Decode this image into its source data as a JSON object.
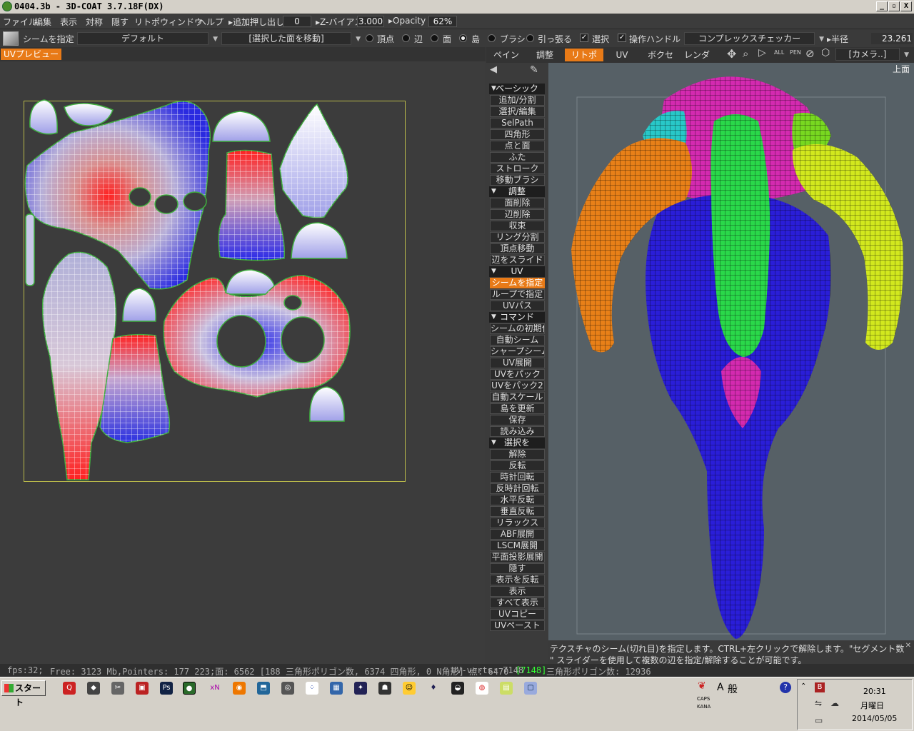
{
  "window": {
    "title": "0404.3b - 3D-COAT 3.7.18F(DX)",
    "buttons": [
      "_",
      "▫",
      "X"
    ]
  },
  "menu": {
    "items": [
      "ファイル",
      "編集",
      "表示",
      "対称",
      "隠す",
      "リトポ",
      "ウィンドウ",
      "ヘルプ"
    ],
    "extrude_label": "▸追加押し出し",
    "extrude_value": "0",
    "zbias_label": "▸Z-バイアス",
    "zbias_value": "3.000",
    "opacity_label": "▸Opacity",
    "opacity_value": "62%"
  },
  "toolbar": {
    "tool_name": "シームを指定",
    "preset": "デフォルト",
    "move_mode": "[選択した面を移動]",
    "radios": [
      {
        "label": "頂点",
        "on": false
      },
      {
        "label": "辺",
        "on": false
      },
      {
        "label": "面",
        "on": false
      },
      {
        "label": "島",
        "on": true
      },
      {
        "label": "ブラシ",
        "on": false
      },
      {
        "label": "引っ張る",
        "on": false
      }
    ],
    "select_label": "選択",
    "handle_label": "操作ハンドル",
    "checker": "コンプレックスチェッカー",
    "radius_label": "▸半径",
    "radius_value": "23.261"
  },
  "uv": {
    "tab": "UVプレビュー"
  },
  "right_tabs": [
    "ペイント",
    "調整",
    "リトポ",
    "UV",
    "ボクセル",
    "レンダー"
  ],
  "camera": "[カメラ..]",
  "view_label": "上面",
  "sections": [
    {
      "title": "ベーシック",
      "items": [
        "追加/分割",
        "選択/編集",
        "SelPath",
        "四角形",
        "点と面",
        "ふた",
        "ストローク",
        "移動ブラシ"
      ]
    },
    {
      "title": "調整",
      "items": [
        "面削除",
        "辺削除",
        "収束",
        "リング分割",
        "頂点移動",
        "辺をスライド"
      ]
    },
    {
      "title": "UV",
      "items": [
        "シームを指定",
        "ループで指定",
        "UVパス"
      ]
    },
    {
      "title": "コマンド",
      "items": [
        "シームの初期化",
        "自動シーム",
        "シャープシーム",
        "UV展開",
        "UVをパック",
        "UVをパック2",
        "自動スケール",
        "島を更新",
        "保存",
        "読み込み"
      ]
    },
    {
      "title": "選択を",
      "items": [
        "解除",
        "反転",
        "時計回転",
        "反時計回転",
        "水平反転",
        "垂直反転",
        "リラックス",
        "ABF展開",
        "LSCM展開",
        "平面投影展開",
        "隠す",
        "表示を反転",
        "表示",
        "すべて表示",
        "UVコピー",
        "UVペースト"
      ]
    }
  ],
  "hint": {
    "line1": "テクスチャのシーム(切れ目)を指定します。CTRL+左クリックで解除します。\"セグメント数",
    "line2": "\" スライダーを使用して複数の辺を指定/解除することが可能です。"
  },
  "status": {
    "fps": "fps:32;",
    "mem": "Free: 3123 Mb,Pointers: 177 223;面: 6562 [188 三角形ポリゴン数, 6374 四角形, 0 N角形] 点: 6470",
    "uv_label": "UV-verts: 7148 ",
    "uv_hl": "[7148]",
    "tri": "三角形ポリゴン数: 12936"
  },
  "taskbar": {
    "start": "スタート",
    "ime": "般",
    "caps": "CAPS",
    "kana": "KANA",
    "time": "20:31",
    "day": "月曜日",
    "date": "2014/05/05"
  }
}
